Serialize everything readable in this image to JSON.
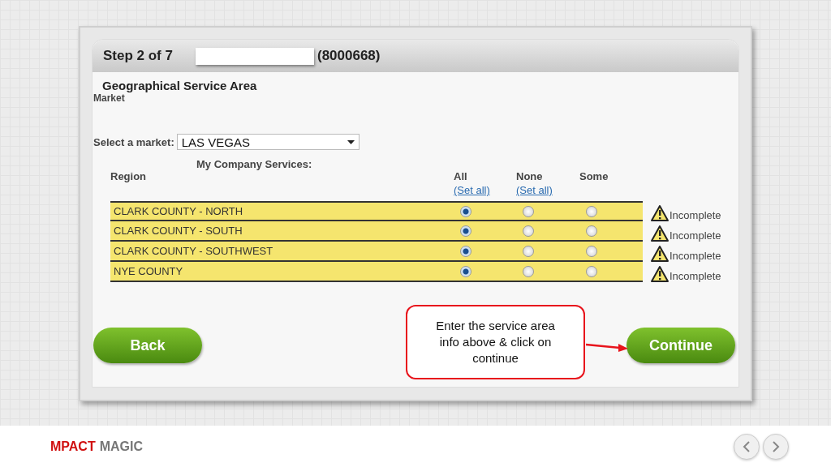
{
  "header": {
    "step": "Step 2 of 7",
    "account": "(8000668)"
  },
  "section_title": "Geographical Service Area",
  "section_subtitle": "Market",
  "market": {
    "label": "Select a market:",
    "value": "LAS VEGAS"
  },
  "services_heading": "My Company Services:",
  "columns": [
    {
      "title": "Region"
    },
    {
      "title": "All",
      "link": "(Set all)"
    },
    {
      "title": "None",
      "link": "(Set all)"
    },
    {
      "title": "Some"
    }
  ],
  "rows": [
    {
      "region": "CLARK COUNTY - NORTH",
      "options": [
        {
          "selected": true
        },
        {
          "selected": false
        },
        {
          "selected": false
        }
      ],
      "status": "Incomplete"
    },
    {
      "region": "CLARK COUNTY - SOUTH",
      "options": [
        {
          "selected": true
        },
        {
          "selected": false
        },
        {
          "selected": false
        }
      ],
      "status": "Incomplete"
    },
    {
      "region": "CLARK COUNTY - SOUTHWEST",
      "options": [
        {
          "selected": true
        },
        {
          "selected": false
        },
        {
          "selected": false
        }
      ],
      "status": "Incomplete"
    },
    {
      "region": "NYE COUNTY",
      "options": [
        {
          "selected": true
        },
        {
          "selected": false
        },
        {
          "selected": false
        }
      ],
      "status": "Incomplete"
    }
  ],
  "buttons": {
    "back": "Back",
    "continue": "Continue"
  },
  "callout": "Enter the service area info above & click on continue",
  "footer": {
    "brand_primary": "MPACT",
    "brand_secondary": "MAGIC"
  }
}
